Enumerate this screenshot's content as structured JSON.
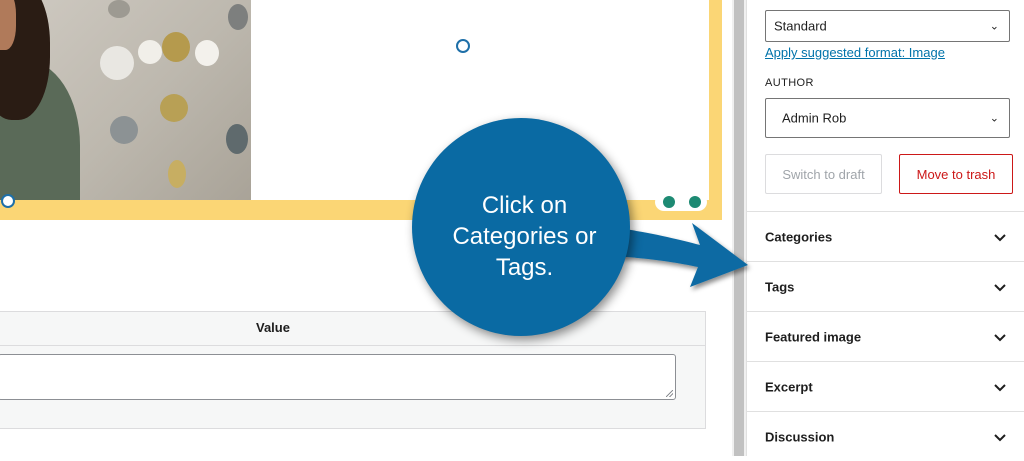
{
  "editor": {
    "custom_fields": {
      "value_header": "Value",
      "value_input": ""
    }
  },
  "sidebar": {
    "post_format": {
      "selected": "Standard",
      "suggest_link": "Apply suggested format: Image"
    },
    "author": {
      "label": "AUTHOR",
      "selected": "Admin Rob"
    },
    "actions": {
      "switch_to_draft": "Switch to draft",
      "move_to_trash": "Move to trash"
    },
    "panels": [
      {
        "label": "Categories"
      },
      {
        "label": "Tags"
      },
      {
        "label": "Featured image"
      },
      {
        "label": "Excerpt"
      },
      {
        "label": "Discussion"
      }
    ]
  },
  "callout": {
    "text_line1": "Click on",
    "text_line2": "Categories or",
    "text_line3": "Tags."
  },
  "colors": {
    "accent": "#0a6aa3",
    "yellow_block": "#fbd675",
    "trash": "#cc1818",
    "link": "#0073aa"
  },
  "icons": [
    "chevron-down-icon",
    "arrow-right-icon"
  ]
}
